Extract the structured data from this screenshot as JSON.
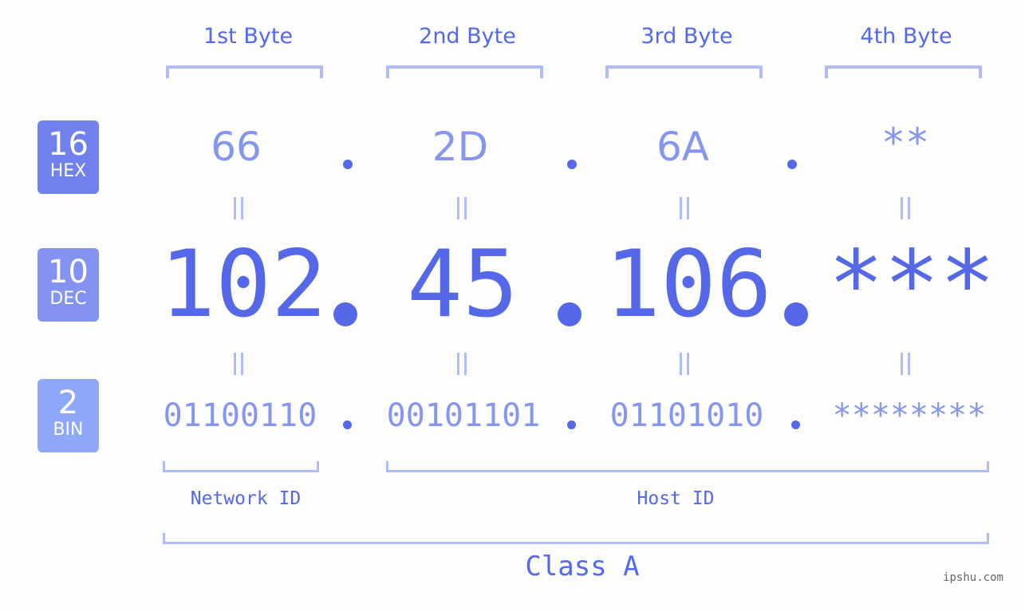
{
  "bytes": {
    "labels": [
      "1st Byte",
      "2nd Byte",
      "3rd Byte",
      "4th Byte"
    ]
  },
  "badges": {
    "hex": {
      "number": "16",
      "label": "HEX",
      "color": "#7080ec"
    },
    "dec": {
      "number": "10",
      "label": "DEC",
      "color": "#8493f2"
    },
    "bin": {
      "number": "2",
      "label": "BIN",
      "color": "#8fa7f8"
    }
  },
  "ip": {
    "hex": [
      "66",
      "2D",
      "6A",
      "**"
    ],
    "dec": [
      "102",
      "45",
      "106",
      "***"
    ],
    "bin": [
      "01100110",
      "00101101",
      "01101010",
      "********"
    ],
    "separator": "."
  },
  "segments": {
    "network_id": "Network ID",
    "host_id": "Host ID",
    "class": "Class A"
  },
  "watermark": "ipshu.com",
  "colors": {
    "primary": "#5468e8",
    "light": "#8695ee",
    "bracket": "#b1bbf6",
    "background": "#fcfdfc"
  }
}
